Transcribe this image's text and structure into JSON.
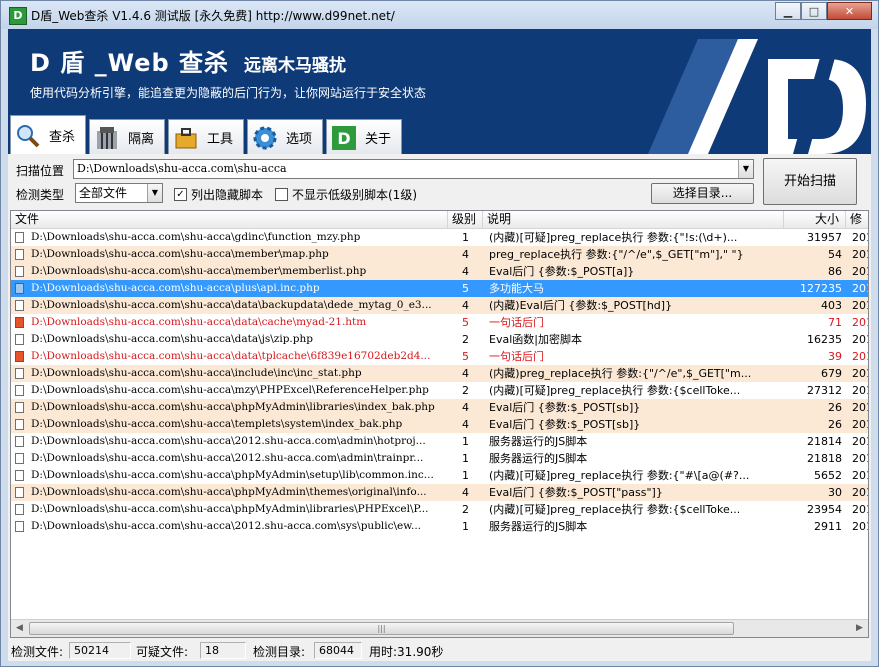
{
  "window": {
    "title": "D盾_Web查杀 V1.4.6 测试版 [永久免费] http://www.d99net.net/",
    "minimize_glyph": "▁",
    "maximize_glyph": "□",
    "close_glyph": "✕"
  },
  "banner": {
    "title": "D 盾 _Web 查杀",
    "subtitle": "远离木马骚扰",
    "description": "使用代码分析引擎，能追查更为隐蔽的后门行为，让你网站运行于安全状态"
  },
  "tabs": [
    {
      "label": "查杀",
      "icon": "magnifier-icon",
      "active": true
    },
    {
      "label": "隔离",
      "icon": "jail-icon",
      "active": false
    },
    {
      "label": "工具",
      "icon": "toolbox-icon",
      "active": false
    },
    {
      "label": "选项",
      "icon": "gear-icon",
      "active": false
    },
    {
      "label": "关于",
      "icon": "d-logo-icon",
      "active": false
    }
  ],
  "scan": {
    "path_label": "扫描位置",
    "path_value": "D:\\Downloads\\shu-acca.com\\shu-acca",
    "type_label": "检测类型",
    "type_value": "全部文件",
    "show_hidden_label": "列出隐藏脚本",
    "show_hidden_checked": true,
    "hide_low_label": "不显示低级别脚本(1级)",
    "hide_low_checked": false,
    "choose_dir_label": "选择目录...",
    "start_label": "开始扫描"
  },
  "table": {
    "columns": [
      "文件",
      "级别",
      "说明",
      "大小",
      "修"
    ],
    "rows": [
      {
        "file": "D:\\Downloads\\shu-acca.com\\shu-acca\\gdinc\\function_mzy.php",
        "level": "1",
        "desc": "(内藏)[可疑]preg_replace执行 参数:{\"!s:(\\d+)...",
        "size": "31957",
        "mod": "201",
        "style": "white",
        "icon": "doc"
      },
      {
        "file": "D:\\Downloads\\shu-acca.com\\shu-acca\\member\\map.php",
        "level": "4",
        "desc": "preg_replace执行 参数:{\"/^/e\",$_GET[\"m\"],\" \"}",
        "size": "54",
        "mod": "201",
        "style": "beige",
        "icon": "doc"
      },
      {
        "file": "D:\\Downloads\\shu-acca.com\\shu-acca\\member\\memberlist.php",
        "level": "4",
        "desc": "Eval后门 {参数:$_POST[a]}",
        "size": "86",
        "mod": "201",
        "style": "beige",
        "icon": "doc"
      },
      {
        "file": "D:\\Downloads\\shu-acca.com\\shu-acca\\plus\\api.inc.php",
        "level": "5",
        "desc": "多功能大马",
        "size": "127235",
        "mod": "201",
        "style": "selected",
        "icon": "blue"
      },
      {
        "file": "D:\\Downloads\\shu-acca.com\\shu-acca\\data\\backupdata\\dede_mytag_0_e3...",
        "level": "4",
        "desc": "(内藏)Eval后门 {参数:$_POST[hd]}",
        "size": "403",
        "mod": "201",
        "style": "beige",
        "icon": "doc"
      },
      {
        "file": "D:\\Downloads\\shu-acca.com\\shu-acca\\data\\cache\\myad-21.htm",
        "level": "5",
        "desc": "一句话后门",
        "size": "71",
        "mod": "201",
        "style": "red",
        "icon": "red"
      },
      {
        "file": "D:\\Downloads\\shu-acca.com\\shu-acca\\data\\js\\zip.php",
        "level": "2",
        "desc": "Eval函数|加密脚本",
        "size": "16235",
        "mod": "201",
        "style": "white",
        "icon": "doc"
      },
      {
        "file": "D:\\Downloads\\shu-acca.com\\shu-acca\\data\\tplcache\\6f839e16702deb2d4...",
        "level": "5",
        "desc": "一句话后门",
        "size": "39",
        "mod": "201",
        "style": "red",
        "icon": "red"
      },
      {
        "file": "D:\\Downloads\\shu-acca.com\\shu-acca\\include\\inc\\inc_stat.php",
        "level": "4",
        "desc": "(内藏)preg_replace执行 参数:{\"/^/e\",$_GET[\"m...",
        "size": "679",
        "mod": "201",
        "style": "beige",
        "icon": "doc"
      },
      {
        "file": "D:\\Downloads\\shu-acca.com\\shu-acca\\mzy\\PHPExcel\\ReferenceHelper.php",
        "level": "2",
        "desc": "(内藏)[可疑]preg_replace执行 参数:{$cellToke...",
        "size": "27312",
        "mod": "201",
        "style": "white",
        "icon": "doc"
      },
      {
        "file": "D:\\Downloads\\shu-acca.com\\shu-acca\\phpMyAdmin\\libraries\\index_bak.php",
        "level": "4",
        "desc": "Eval后门 {参数:$_POST[sb]}",
        "size": "26",
        "mod": "201",
        "style": "beige",
        "icon": "doc"
      },
      {
        "file": "D:\\Downloads\\shu-acca.com\\shu-acca\\templets\\system\\index_bak.php",
        "level": "4",
        "desc": "Eval后门 {参数:$_POST[sb]}",
        "size": "26",
        "mod": "201",
        "style": "beige",
        "icon": "doc"
      },
      {
        "file": "D:\\Downloads\\shu-acca.com\\shu-acca\\2012.shu-acca.com\\admin\\hotproj...",
        "level": "1",
        "desc": "服务器运行的JS脚本",
        "size": "21814",
        "mod": "201",
        "style": "white",
        "icon": "doc"
      },
      {
        "file": "D:\\Downloads\\shu-acca.com\\shu-acca\\2012.shu-acca.com\\admin\\trainpr...",
        "level": "1",
        "desc": "服务器运行的JS脚本",
        "size": "21818",
        "mod": "201",
        "style": "white",
        "icon": "doc"
      },
      {
        "file": "D:\\Downloads\\shu-acca.com\\shu-acca\\phpMyAdmin\\setup\\lib\\common.inc...",
        "level": "1",
        "desc": "(内藏)[可疑]preg_replace执行 参数:{\"#\\[a@(#?...",
        "size": "5652",
        "mod": "201",
        "style": "white",
        "icon": "doc"
      },
      {
        "file": "D:\\Downloads\\shu-acca.com\\shu-acca\\phpMyAdmin\\themes\\original\\info...",
        "level": "4",
        "desc": "Eval后门 {参数:$_POST[\"pass\"]}",
        "size": "30",
        "mod": "201",
        "style": "beige",
        "icon": "doc"
      },
      {
        "file": "D:\\Downloads\\shu-acca.com\\shu-acca\\phpMyAdmin\\libraries\\PHPExcel\\P...",
        "level": "2",
        "desc": "(内藏)[可疑]preg_replace执行 参数:{$cellToke...",
        "size": "23954",
        "mod": "201",
        "style": "white",
        "icon": "doc"
      },
      {
        "file": "D:\\Downloads\\shu-acca.com\\shu-acca\\2012.shu-acca.com\\sys\\public\\ew...",
        "level": "1",
        "desc": "服务器运行的JS脚本",
        "size": "2911",
        "mod": "201",
        "style": "white",
        "icon": "doc"
      }
    ]
  },
  "scrollbar": {
    "left_arrow": "◀",
    "right_arrow": "▶",
    "grip": "|||"
  },
  "status": {
    "files_label": "检测文件:",
    "files_value": "50214",
    "suspicious_label": "可疑文件:",
    "suspicious_value": "18",
    "dirs_label": "检测目录:",
    "dirs_value": "68044",
    "time_text": "用时:31.90秒"
  }
}
